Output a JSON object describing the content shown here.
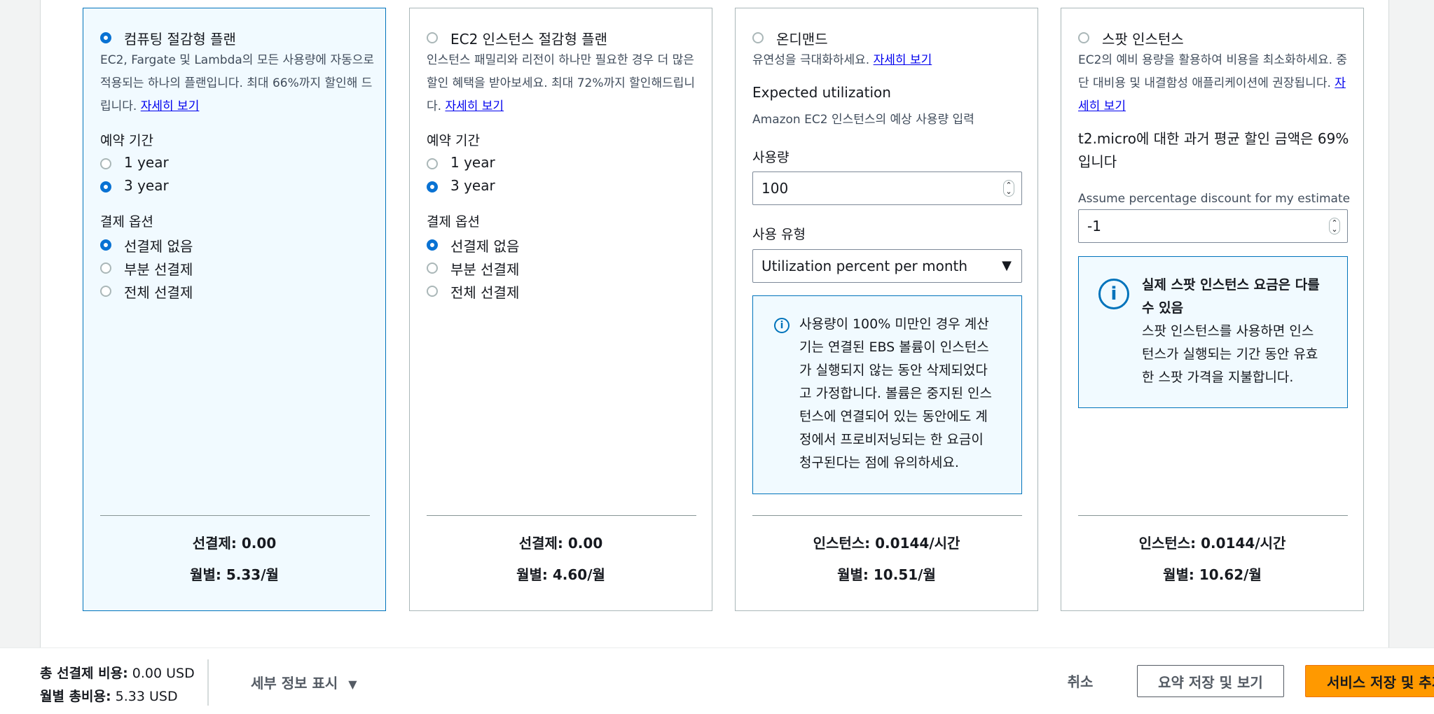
{
  "cards": {
    "savings_plan": {
      "title": "컴퓨팅 절감형 플랜",
      "desc_1": "EC2, Fargate 및 Lambda의 모든 사용량에 자동으로",
      "desc_2": "적용되는 하나의 플랜입니다. 최대 66%까지 할인해 드",
      "desc_3": "립니다.",
      "link": "자세히 보기",
      "term_label": "예약 기간",
      "term_options": [
        "1 year",
        "3 year"
      ],
      "payment_label": "결제 옵션",
      "payment_options": [
        "선결제 없음",
        "부분 선결제",
        "전체 선결제"
      ],
      "upfront": "선결제: 0.00",
      "monthly": "월별: 5.33/월"
    },
    "ec2_plan": {
      "title": "EC2 인스턴스 절감형 플랜",
      "desc_1": "인스턴스 패밀리와 리전이 하나만 필요한 경우 더 많은",
      "desc_2": "할인 혜택을 받아보세요. 최대 72%까지 할인해드립니",
      "desc_3": "다.",
      "link": "자세히 보기",
      "term_label": "예약 기간",
      "term_options": [
        "1 year",
        "3 year"
      ],
      "payment_label": "결제 옵션",
      "payment_options": [
        "선결제 없음",
        "부분 선결제",
        "전체 선결제"
      ],
      "upfront": "선결제: 0.00",
      "monthly": "월별: 4.60/월"
    },
    "on_demand": {
      "title": "온디맨드",
      "desc": "유연성을 극대화하세요.",
      "link": "자세히 보기",
      "util_title": "Expected utilization",
      "util_desc": "Amazon EC2 인스턴스의 예상 사용량 입력",
      "usage_label": "사용량",
      "usage_value": "100",
      "type_label": "사용 유형",
      "type_value": "Utilization percent per month",
      "info_lines": [
        "사용량이 100% 미만인 경우 계산",
        "기는 연결된 EBS 볼륨이 인스턴스",
        "가 실행되지 않는 동안 삭제되었다",
        "고 가정합니다. 볼륨은 중지된 인스",
        "턴스에 연결되어 있는 동안에도 계",
        "정에서 프로비저닝되는 한 요금이",
        "청구된다는 점에 유의하세요."
      ],
      "instance_price": "인스턴스: 0.0144/시간",
      "monthly": "월별: 10.51/월"
    },
    "spot": {
      "title": "스팟 인스턴스",
      "desc_1": "EC2의 예비 용량을 활용하여 비용을 최소화하세요. 중",
      "desc_2": "단 대비용 및 내결함성 애플리케이션에 권장됩니다.",
      "link_1": "자",
      "link_2": "세히 보기",
      "hist_1": "t2.micro에 대한 과거 평균 할인 금액은 69%",
      "hist_2": "입니다",
      "assume_label": "Assume percentage discount for my estimate",
      "assume_value": "-1",
      "info_title_1": "실제 스팟 인스턴스 요금은 다를",
      "info_title_2": "수 있음",
      "info_lines": [
        "스팟 인스턴스를 사용하면 인스",
        "턴스가 실행되는 기간 동안 유효",
        "한 스팟 가격을 지불합니다."
      ],
      "instance_price": "인스턴스: 0.0144/시간",
      "monthly": "월별: 10.62/월"
    }
  },
  "footer": {
    "upfront_label": "총 선결제 비용:",
    "upfront_value": "0.00 USD",
    "monthly_label": "월별 총비용:",
    "monthly_value": "5.33 USD",
    "details_toggle": "세부 정보 표시",
    "cancel": "취소",
    "save_summary": "요약 저장 및 보기",
    "save_add": "서비스 저장 및 추가"
  },
  "colors": {
    "selected_border": "#0073bb",
    "selected_bg": "#f1faff",
    "primary_button": "#ff9900",
    "radio_on": "#0972d3"
  }
}
